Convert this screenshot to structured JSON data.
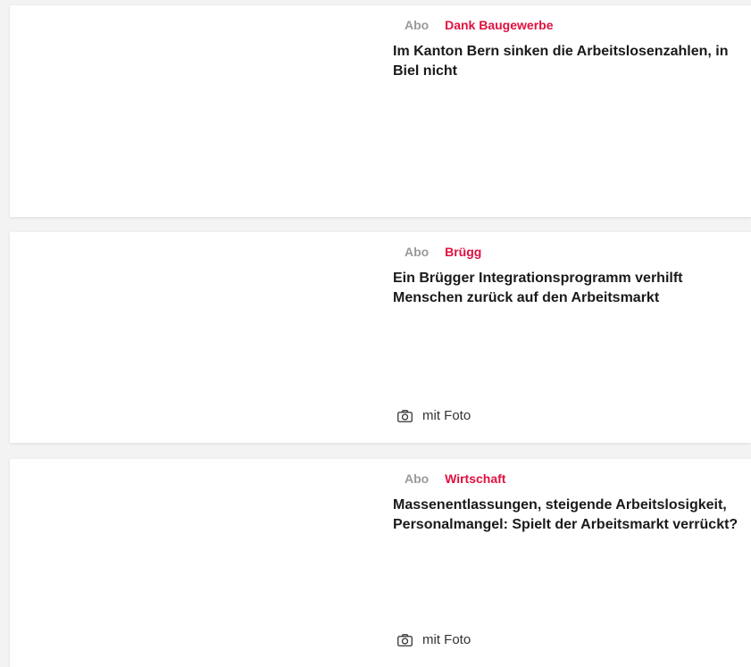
{
  "articles": [
    {
      "abo_label": "Abo",
      "kicker": "Dank Baugewerbe",
      "headline": "Im Kanton Bern sinken die Arbeitslosenzahlen, in Biel nicht",
      "media_label": null
    },
    {
      "abo_label": "Abo",
      "kicker": "Brügg",
      "headline": "Ein Brügger Integrationsprogramm verhilft Menschen zurück auf den Arbeitsmarkt",
      "media_label": "mit Foto",
      "media_icon": "camera-icon"
    },
    {
      "abo_label": "Abo",
      "kicker": "Wirtschaft",
      "headline": "Massenentlassungen, steigende Arbeitslosigkeit, Personalmangel: Spielt der Arbeitsmarkt verrückt?",
      "media_label": "mit Foto",
      "media_icon": "camera-icon"
    }
  ],
  "colors": {
    "kicker": "#e0103f",
    "abo": "#9a9a9a",
    "headline": "#1a1a1a",
    "background": "#f3f3f3",
    "card": "#ffffff"
  }
}
